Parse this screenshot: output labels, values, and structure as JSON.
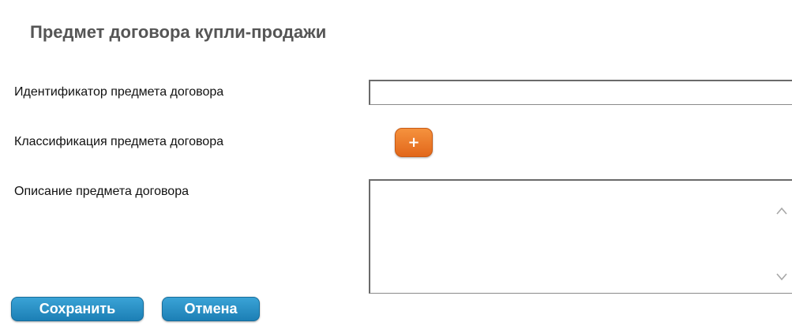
{
  "page": {
    "title": "Предмет договора купли-продажи"
  },
  "form": {
    "identifier": {
      "label": "Идентификатор предмета договора",
      "value": "",
      "placeholder": ""
    },
    "classification": {
      "label": "Классификация предмета договора",
      "add_button_glyph": "+",
      "add_icon": "plus-icon"
    },
    "description": {
      "label": "Описание предмета договора",
      "value": "",
      "scroll_up_icon": "chevron-up-icon",
      "scroll_down_icon": "chevron-down-icon"
    }
  },
  "actions": {
    "save_label": "Сохранить",
    "cancel_label": "Отмена"
  },
  "colors": {
    "title": "#555555",
    "add_button": "#ef7d2a",
    "action_button": "#2a90c5",
    "action_text": "#ffffff"
  }
}
